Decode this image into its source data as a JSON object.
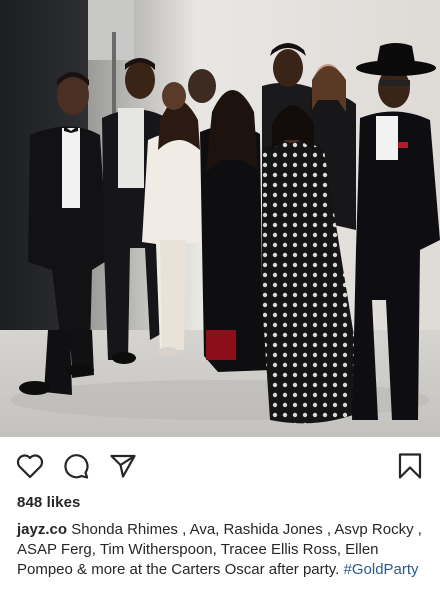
{
  "post": {
    "likes_text": "848 likes",
    "username": "jayz.co",
    "caption_text": " Shonda Rhimes , Ava, Rashida Jones , Asvp Rocky , ASAP Ferg, Tim Witherspoon, Tracee Ellis Ross, Ellen Pompeo & more at the Carters Oscar after party. ",
    "hashtag": "#GoldParty"
  },
  "icons": {
    "like": "heart-outline-icon",
    "comment": "comment-bubble-icon",
    "share": "paper-plane-icon",
    "save": "bookmark-icon"
  }
}
